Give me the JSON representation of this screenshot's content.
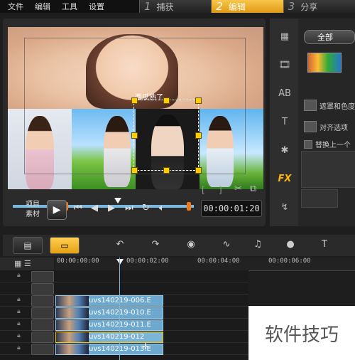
{
  "menu": [
    "文件",
    "编辑",
    "工具",
    "设置"
  ],
  "steps": [
    {
      "num": "1",
      "label": "捕获"
    },
    {
      "num": "2",
      "label": "编辑"
    },
    {
      "num": "3",
      "label": "分享"
    }
  ],
  "preview": {
    "overlay_title": "西瓜熟了",
    "label_project": "项目",
    "label_clip": "素材",
    "timecode": "00:00:01:20",
    "scrub_progress": 1.0
  },
  "library": {
    "filter": "全部",
    "options": [
      "遮罩和色度",
      "对齐选项",
      "替换上一个"
    ]
  },
  "timeline": {
    "ticks": [
      "00:00:00:00",
      "00:00:02:00",
      "00:00:04:00",
      "00:00:06:00"
    ],
    "clips": [
      {
        "name": "uvs140219-006.E",
        "selected": false
      },
      {
        "name": "uvs140219-010.E",
        "selected": false
      },
      {
        "name": "uvs140219-011.E",
        "selected": false
      },
      {
        "name": "uvs140219-012",
        "selected": true
      },
      {
        "name": "uvs140219-013.E",
        "selected": false
      }
    ]
  },
  "watermark": "软件技巧",
  "colors": {
    "accent": "#f3b22f",
    "clip": "#6da9cf",
    "playhead": "#7ab8e0"
  }
}
